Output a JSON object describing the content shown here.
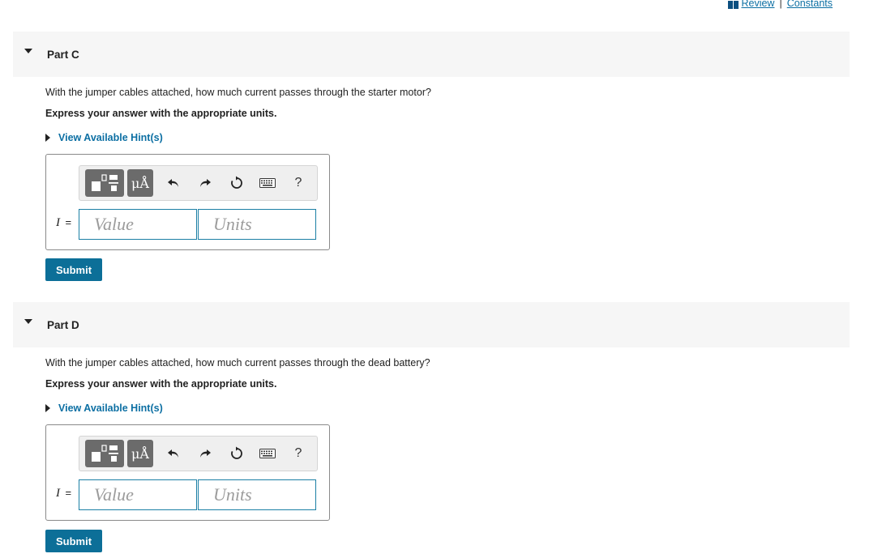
{
  "toplinks": {
    "review": "Review",
    "separator": "|",
    "constants": "Constants"
  },
  "parts": [
    {
      "title": "Part C",
      "question": "With the jumper cables attached, how much current passes through the starter motor?",
      "instruction": "Express your answer with the appropriate units.",
      "hint_label": "View Available Hint(s)",
      "units_button": "μÅ",
      "help": "?",
      "variable": "I",
      "equals": "=",
      "value_placeholder": "Value",
      "units_placeholder": "Units",
      "submit": "Submit"
    },
    {
      "title": "Part D",
      "question": "With the jumper cables attached, how much current passes through the dead battery?",
      "instruction": "Express your answer with the appropriate units.",
      "hint_label": "View Available Hint(s)",
      "units_button": "μÅ",
      "help": "?",
      "variable": "I",
      "equals": "=",
      "value_placeholder": "Value",
      "units_placeholder": "Units",
      "submit": "Submit"
    }
  ]
}
